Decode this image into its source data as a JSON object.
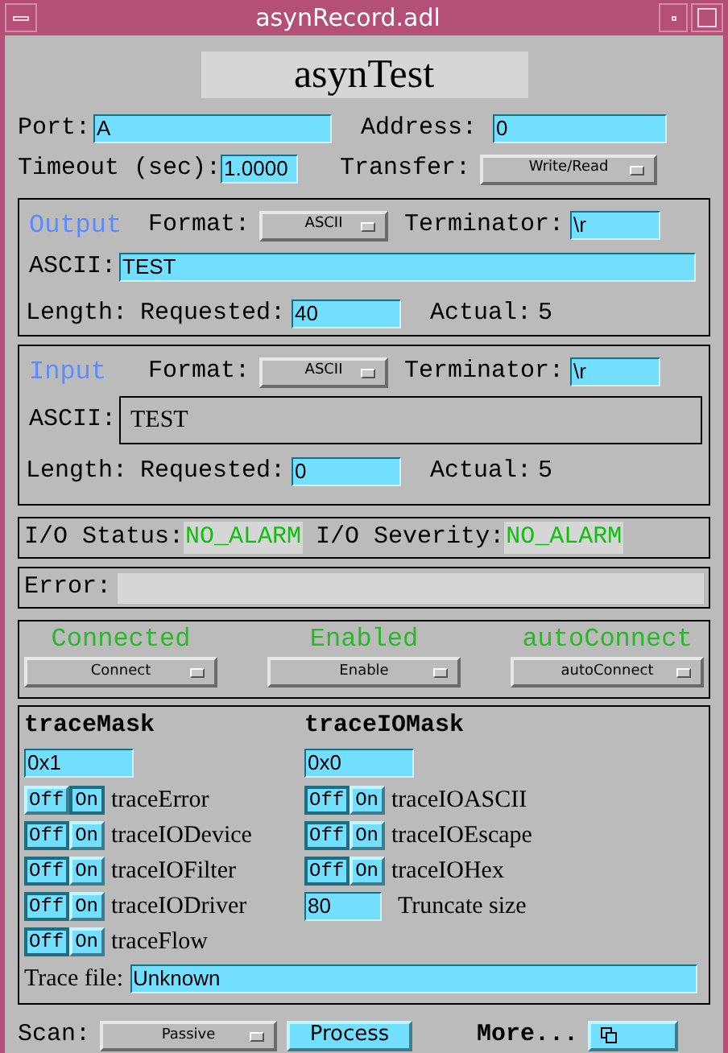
{
  "window": {
    "title": "asynRecord.adl"
  },
  "record_name": "asynTest",
  "port": {
    "label": "Port:",
    "value": "A"
  },
  "address": {
    "label": "Address:",
    "value": "0"
  },
  "timeout": {
    "label": "Timeout (sec):",
    "value": "1.0000"
  },
  "transfer": {
    "label": "Transfer:",
    "value": "Write/Read"
  },
  "io_panels": [
    {
      "title": "Output",
      "format_label": "Format:",
      "format": "ASCII",
      "terminator_label": "Terminator:",
      "terminator": "\\r",
      "ascii_label": "ASCII:",
      "ascii": "TEST",
      "ascii_editable": true,
      "length_label": "Length:",
      "requested_label": "Requested:",
      "requested": "40",
      "actual_label": "Actual:",
      "actual": "5"
    },
    {
      "title": "Input",
      "format_label": "Format:",
      "format": "ASCII",
      "terminator_label": "Terminator:",
      "terminator": "\\r",
      "ascii_label": "ASCII:",
      "ascii": "TEST",
      "ascii_editable": false,
      "length_label": "Length:",
      "requested_label": "Requested:",
      "requested": "0",
      "actual_label": "Actual:",
      "actual": "5"
    }
  ],
  "io_status": {
    "status_label": "I/O Status:",
    "status": "NO_ALARM",
    "severity_label": "I/O Severity:",
    "severity": "NO_ALARM"
  },
  "error": {
    "label": "Error:"
  },
  "connection": [
    {
      "status": "Connected",
      "menu": "Connect"
    },
    {
      "status": "Enabled",
      "menu": "Enable"
    },
    {
      "status": "autoConnect",
      "menu": "autoConnect"
    }
  ],
  "trace_mask": {
    "title": "traceMask",
    "value": "0x1",
    "flags": [
      {
        "off_label": "Off",
        "on_label": "On",
        "label": "traceError",
        "on": true
      },
      {
        "off_label": "Off",
        "on_label": "On",
        "label": "traceIODevice",
        "on": false
      },
      {
        "off_label": "Off",
        "on_label": "On",
        "label": "traceIOFilter",
        "on": false
      },
      {
        "off_label": "Off",
        "on_label": "On",
        "label": "traceIODriver",
        "on": false
      },
      {
        "off_label": "Off",
        "on_label": "On",
        "label": "traceFlow",
        "on": false
      }
    ]
  },
  "trace_io_mask": {
    "title": "traceIOMask",
    "value": "0x0",
    "flags": [
      {
        "off_label": "Off",
        "on_label": "On",
        "label": "traceIOASCII",
        "on": false
      },
      {
        "off_label": "Off",
        "on_label": "On",
        "label": "traceIOEscape",
        "on": false
      },
      {
        "off_label": "Off",
        "on_label": "On",
        "label": "traceIOHex",
        "on": false
      }
    ],
    "truncate": {
      "value": "80",
      "label": "Truncate size"
    }
  },
  "trace_file": {
    "label": "Trace file:",
    "value": "Unknown"
  },
  "bottom": {
    "scan_label": "Scan:",
    "scan": "Passive",
    "process": "Process",
    "more_label": "More..."
  }
}
